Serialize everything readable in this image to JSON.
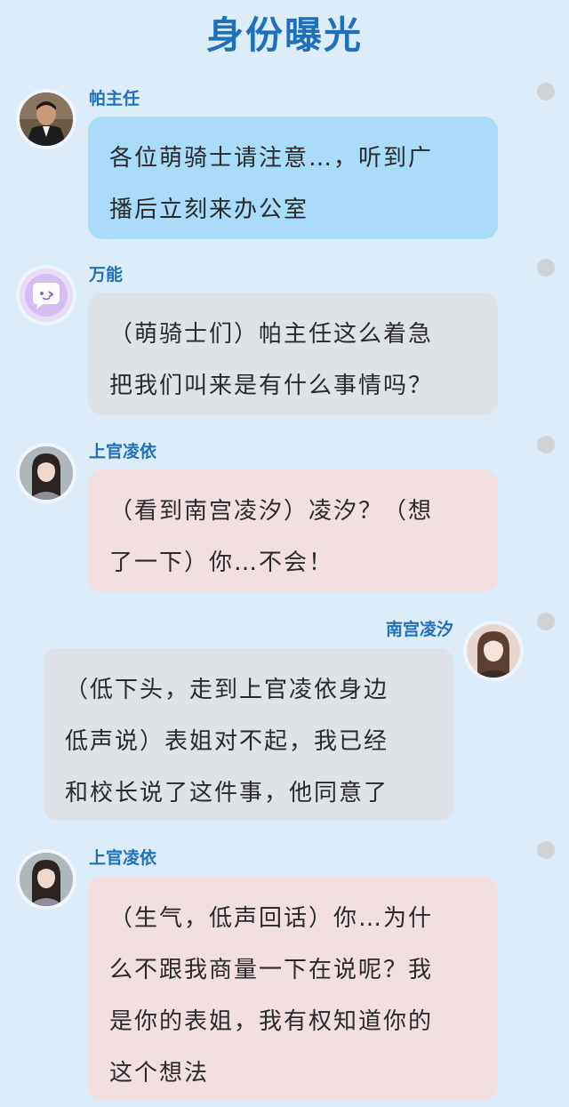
{
  "page": {
    "title": "身份曝光"
  },
  "messages": [
    {
      "sender": "帕主任",
      "side": "left",
      "bubble_color": "#a9dcf8",
      "avatar_icon": "man-in-suit-avatar",
      "lines": [
        "各位萌骑士请注意…，听到广",
        "播后立刻来办公室"
      ]
    },
    {
      "sender": "万能",
      "side": "left",
      "bubble_color": "#dfe3e8",
      "avatar_icon": "chat-bubble-emoji-avatar",
      "lines": [
        "（萌骑士们）帕主任这么着急",
        "把我们叫来是有什么事情吗？"
      ]
    },
    {
      "sender": "上官凌依",
      "side": "left",
      "bubble_color": "#f1dfe2",
      "avatar_icon": "girl-portrait-avatar",
      "lines": [
        "（看到南宫凌汐）凌汐？（想",
        "了一下）你…不会！"
      ]
    },
    {
      "sender": "南宫凌汐",
      "side": "right",
      "bubble_color": "#dfe3e8",
      "avatar_icon": "girl-portrait-avatar",
      "lines": [
        "（低下头，走到上官凌依身边",
        "低声说）表姐对不起，我已经",
        "和校长说了这件事，他同意了"
      ]
    },
    {
      "sender": "上官凌依",
      "side": "left",
      "bubble_color": "#f1dfe2",
      "avatar_icon": "girl-portrait-avatar",
      "lines": [
        "（生气，低声回话）你…为什",
        "么不跟我商量一下在说呢？我",
        "是你的表姐，我有权知道你的",
        "这个想法"
      ]
    }
  ]
}
